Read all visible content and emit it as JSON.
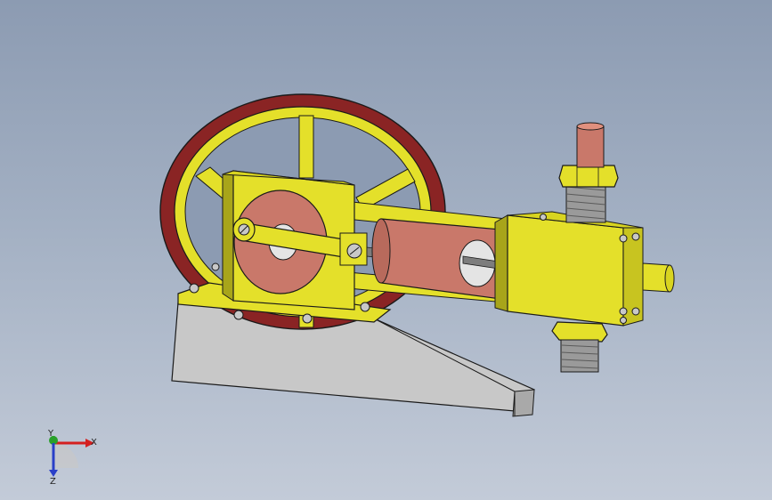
{
  "viewport": {
    "colors": {
      "bg_top": "#8c9bb2",
      "bg_bottom": "#c3cbd8",
      "brass": "#e4e02a",
      "brass_dark": "#a8a51a",
      "outline": "#1a1a1a",
      "copper": "#c9786a",
      "flywheel_rim": "#8a2424",
      "base": "#c8c8c8",
      "steel": "#7d7d7d"
    },
    "model": {
      "parts": [
        "flywheel",
        "frame",
        "crank-disc",
        "connecting-rod",
        "cylinder",
        "cylinder-head",
        "steam-pipe",
        "exhaust-pipe",
        "base-block",
        "hex-nuts",
        "bolts"
      ]
    }
  },
  "triad": {
    "x_label": "X",
    "y_label": "Y",
    "z_label": "Z",
    "x_color": "#d42020",
    "y_color": "#2aa02a",
    "z_color": "#2a40c8"
  }
}
